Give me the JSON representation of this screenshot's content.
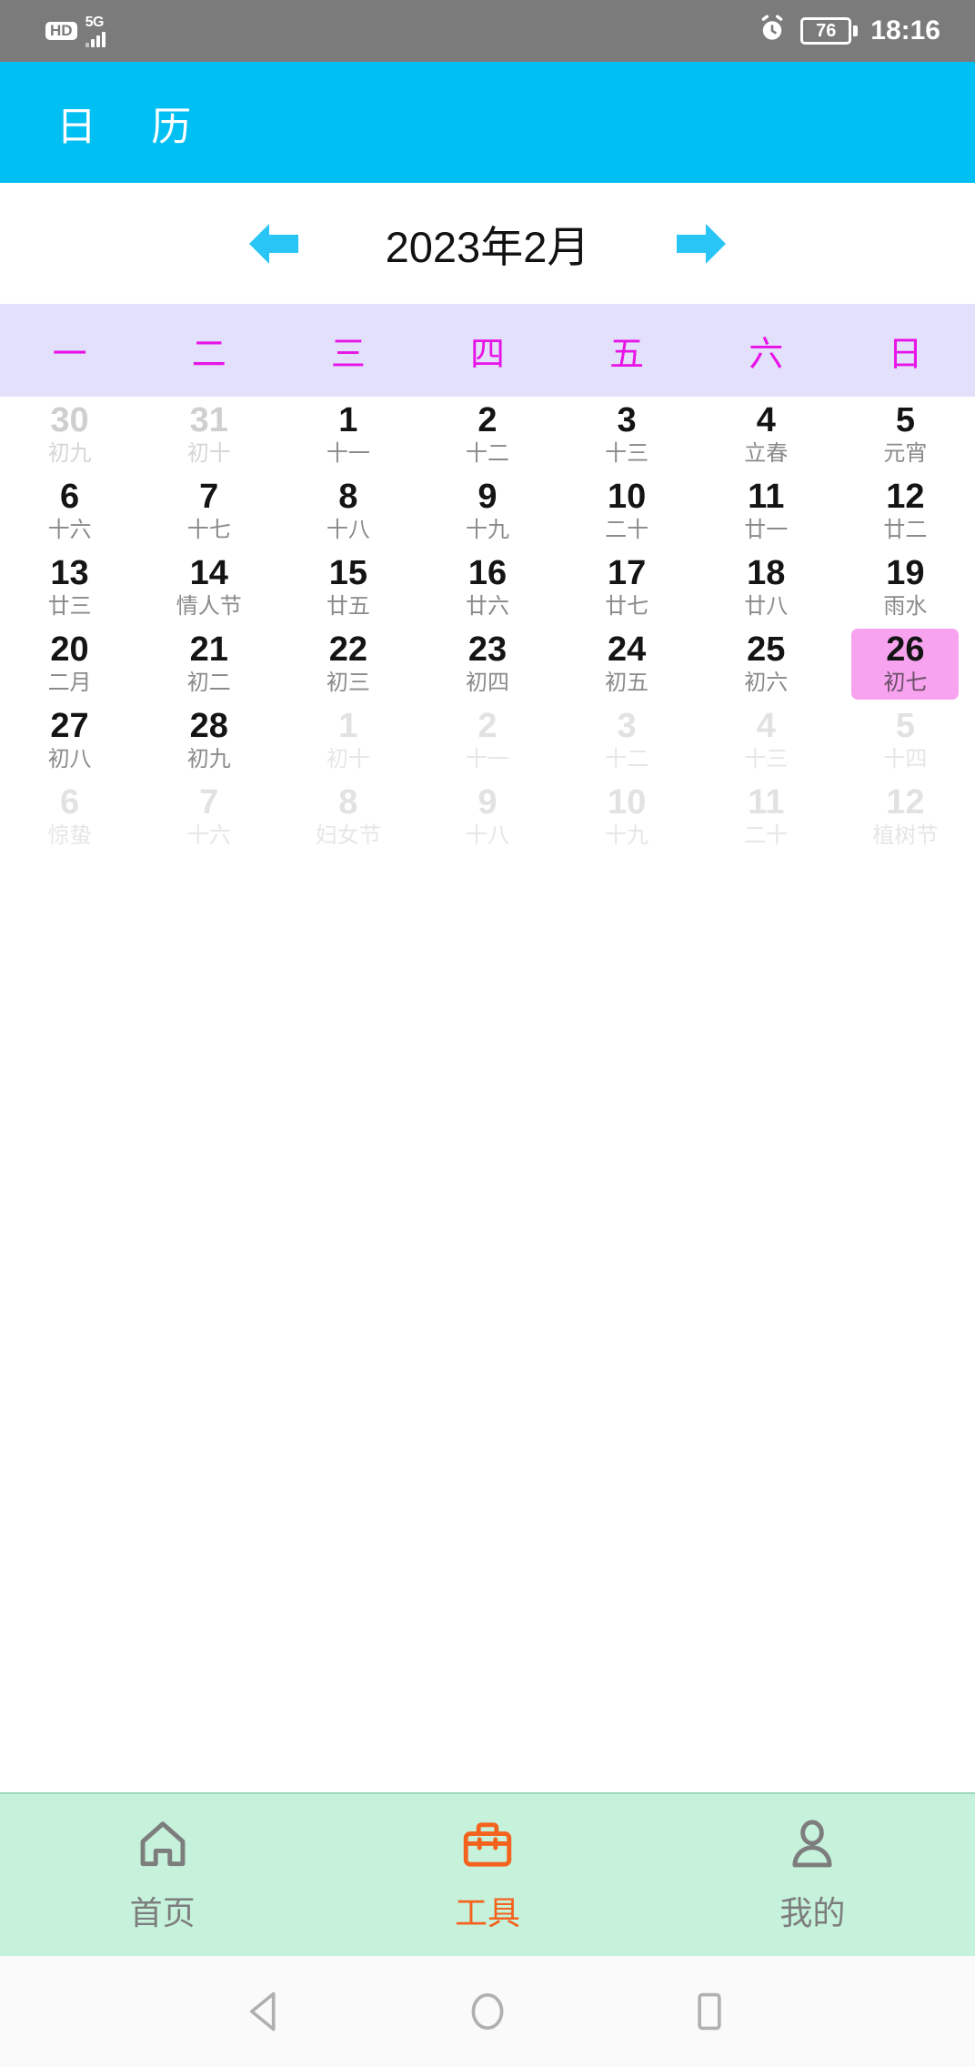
{
  "status_bar": {
    "hd_badge": "HD",
    "network": "5G",
    "signal_icon": "signal-bars-icon",
    "alarm_icon": "alarm-clock-icon",
    "battery_percent": "76",
    "time": "18:16"
  },
  "app_bar": {
    "title": "日 历",
    "background_color": "#00BFF3"
  },
  "month_nav": {
    "prev_icon": "arrow-left-icon",
    "next_icon": "arrow-right-icon",
    "title": "2023年2月",
    "arrow_color": "#29C5F6"
  },
  "weekdays": [
    "一",
    "二",
    "三",
    "四",
    "五",
    "六",
    "日"
  ],
  "weekday_header": {
    "background_color": "#E2E0FA",
    "text_color": "#E813E8"
  },
  "today": {
    "day": "26",
    "lunar": "初七",
    "highlight_color": "#F7A3EF"
  },
  "calendar": {
    "rows": [
      [
        {
          "day": "30",
          "lunar": "初九",
          "state": "muted"
        },
        {
          "day": "31",
          "lunar": "初十",
          "state": "muted"
        },
        {
          "day": "1",
          "lunar": "十一",
          "state": "normal"
        },
        {
          "day": "2",
          "lunar": "十二",
          "state": "normal"
        },
        {
          "day": "3",
          "lunar": "十三",
          "state": "normal"
        },
        {
          "day": "4",
          "lunar": "立春",
          "state": "normal"
        },
        {
          "day": "5",
          "lunar": "元宵",
          "state": "normal"
        }
      ],
      [
        {
          "day": "6",
          "lunar": "十六",
          "state": "normal"
        },
        {
          "day": "7",
          "lunar": "十七",
          "state": "normal"
        },
        {
          "day": "8",
          "lunar": "十八",
          "state": "normal"
        },
        {
          "day": "9",
          "lunar": "十九",
          "state": "normal"
        },
        {
          "day": "10",
          "lunar": "二十",
          "state": "normal"
        },
        {
          "day": "11",
          "lunar": "廿一",
          "state": "normal"
        },
        {
          "day": "12",
          "lunar": "廿二",
          "state": "normal"
        }
      ],
      [
        {
          "day": "13",
          "lunar": "廿三",
          "state": "normal"
        },
        {
          "day": "14",
          "lunar": "情人节",
          "state": "normal"
        },
        {
          "day": "15",
          "lunar": "廿五",
          "state": "normal"
        },
        {
          "day": "16",
          "lunar": "廿六",
          "state": "normal"
        },
        {
          "day": "17",
          "lunar": "廿七",
          "state": "normal"
        },
        {
          "day": "18",
          "lunar": "廿八",
          "state": "normal"
        },
        {
          "day": "19",
          "lunar": "雨水",
          "state": "normal"
        }
      ],
      [
        {
          "day": "20",
          "lunar": "二月",
          "state": "normal"
        },
        {
          "day": "21",
          "lunar": "初二",
          "state": "normal"
        },
        {
          "day": "22",
          "lunar": "初三",
          "state": "normal"
        },
        {
          "day": "23",
          "lunar": "初四",
          "state": "normal"
        },
        {
          "day": "24",
          "lunar": "初五",
          "state": "normal"
        },
        {
          "day": "25",
          "lunar": "初六",
          "state": "normal"
        },
        {
          "day": "26",
          "lunar": "初七",
          "state": "today"
        }
      ],
      [
        {
          "day": "27",
          "lunar": "初八",
          "state": "normal"
        },
        {
          "day": "28",
          "lunar": "初九",
          "state": "normal"
        },
        {
          "day": "1",
          "lunar": "初十",
          "state": "faint"
        },
        {
          "day": "2",
          "lunar": "十一",
          "state": "faint"
        },
        {
          "day": "3",
          "lunar": "十二",
          "state": "faint"
        },
        {
          "day": "4",
          "lunar": "十三",
          "state": "faint"
        },
        {
          "day": "5",
          "lunar": "十四",
          "state": "faint"
        }
      ],
      [
        {
          "day": "6",
          "lunar": "惊蛰",
          "state": "faint"
        },
        {
          "day": "7",
          "lunar": "十六",
          "state": "faint"
        },
        {
          "day": "8",
          "lunar": "妇女节",
          "state": "faint"
        },
        {
          "day": "9",
          "lunar": "十八",
          "state": "faint"
        },
        {
          "day": "10",
          "lunar": "十九",
          "state": "faint"
        },
        {
          "day": "11",
          "lunar": "二十",
          "state": "faint"
        },
        {
          "day": "12",
          "lunar": "植树节",
          "state": "faint"
        }
      ]
    ]
  },
  "tab_bar": {
    "background_color": "#C6F2DC",
    "active_color": "#F4631E",
    "inactive_color": "#7D7D7D",
    "tabs": [
      {
        "label": "首页",
        "icon": "home-icon",
        "active": false
      },
      {
        "label": "工具",
        "icon": "toolbox-icon",
        "active": true
      },
      {
        "label": "我的",
        "icon": "person-icon",
        "active": false
      }
    ]
  },
  "android_nav": {
    "back_icon": "back-triangle-icon",
    "home_icon": "home-circle-icon",
    "recents_icon": "recents-square-icon"
  }
}
